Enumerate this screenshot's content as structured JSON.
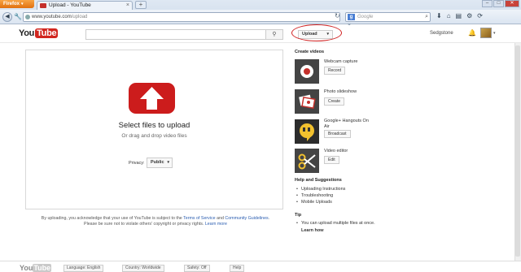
{
  "browser": {
    "app_button": "Firefox",
    "tab_title": "Upload - YouTube",
    "tab_close": "×",
    "new_tab": "+",
    "url_domain": "www.youtube.com",
    "url_path": "/upload",
    "search_placeholder": "Google"
  },
  "header": {
    "logo_you": "You",
    "logo_tube": "Tube",
    "upload_label": "Upload",
    "username": "Sedgstone"
  },
  "upload": {
    "title": "Select files to upload",
    "subtitle": "Or drag and drop video files",
    "privacy_label": "Privacy:",
    "privacy_value": "Public"
  },
  "terms": {
    "text1": "By uploading, you acknowledge that your use of YouTube is subject to the",
    "tos": "Terms of Service",
    "and": "and",
    "guidelines": "Community Guidelines",
    "text2": "Please be sure not to violate others' copyright or privacy rights.",
    "learn": "Learn more"
  },
  "sidebar": {
    "create_heading": "Create videos",
    "items": [
      {
        "label": "Webcam capture",
        "button": "Record",
        "icon": "record-icon"
      },
      {
        "label": "Photo slideshow",
        "button": "Create",
        "icon": "photos-icon"
      },
      {
        "label": "Google+ Hangouts On Air",
        "button": "Broadcast",
        "icon": "hangouts-icon"
      },
      {
        "label": "Video editor",
        "button": "Edit",
        "icon": "scissors-icon"
      }
    ],
    "help_heading": "Help and Suggestions",
    "help_links": [
      "Uploading Instructions",
      "Troubleshooting",
      "Mobile Uploads"
    ],
    "tip_heading": "Tip",
    "tip_text": "You can upload multiple files at once.",
    "tip_link": "Learn how"
  },
  "footer": {
    "logo_you": "You",
    "logo_tube": "Tube",
    "buttons": [
      "Language: English",
      "Country: Worldwide",
      "Safety: Off",
      "Help"
    ]
  },
  "colors": {
    "brand_red": "#cc1c1c",
    "annotation_red": "#d02020",
    "link_blue": "#2a5db0"
  }
}
